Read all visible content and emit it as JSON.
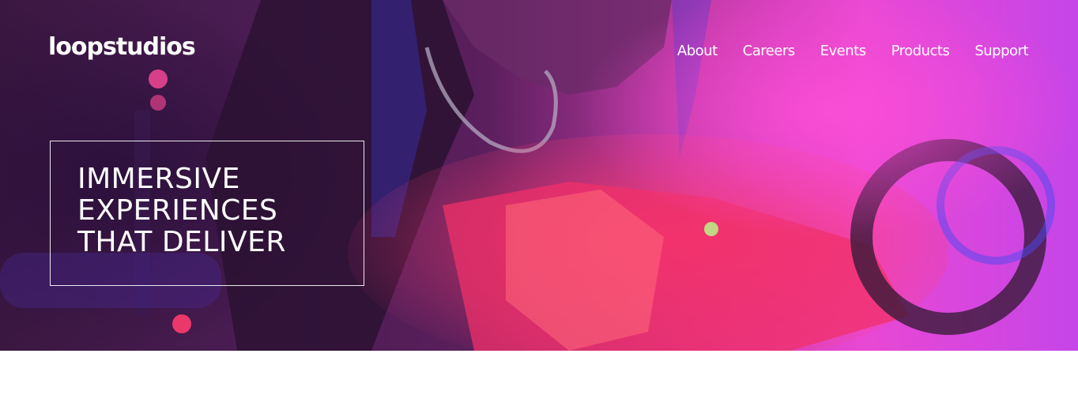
{
  "brand": {
    "logo_text": "loopstudios"
  },
  "nav": {
    "items": [
      {
        "label": "About"
      },
      {
        "label": "Careers"
      },
      {
        "label": "Events"
      },
      {
        "label": "Products"
      },
      {
        "label": "Support"
      }
    ]
  },
  "hero": {
    "headline_lines": [
      "IMMERSIVE",
      "EXPERIENCES",
      "THAT DELIVER"
    ]
  },
  "colors": {
    "text": "#ffffff",
    "hero_dark": "#3a1740",
    "hero_pink": "#e948d3",
    "hero_red": "#f0306a",
    "hero_violet": "#c545e8"
  }
}
